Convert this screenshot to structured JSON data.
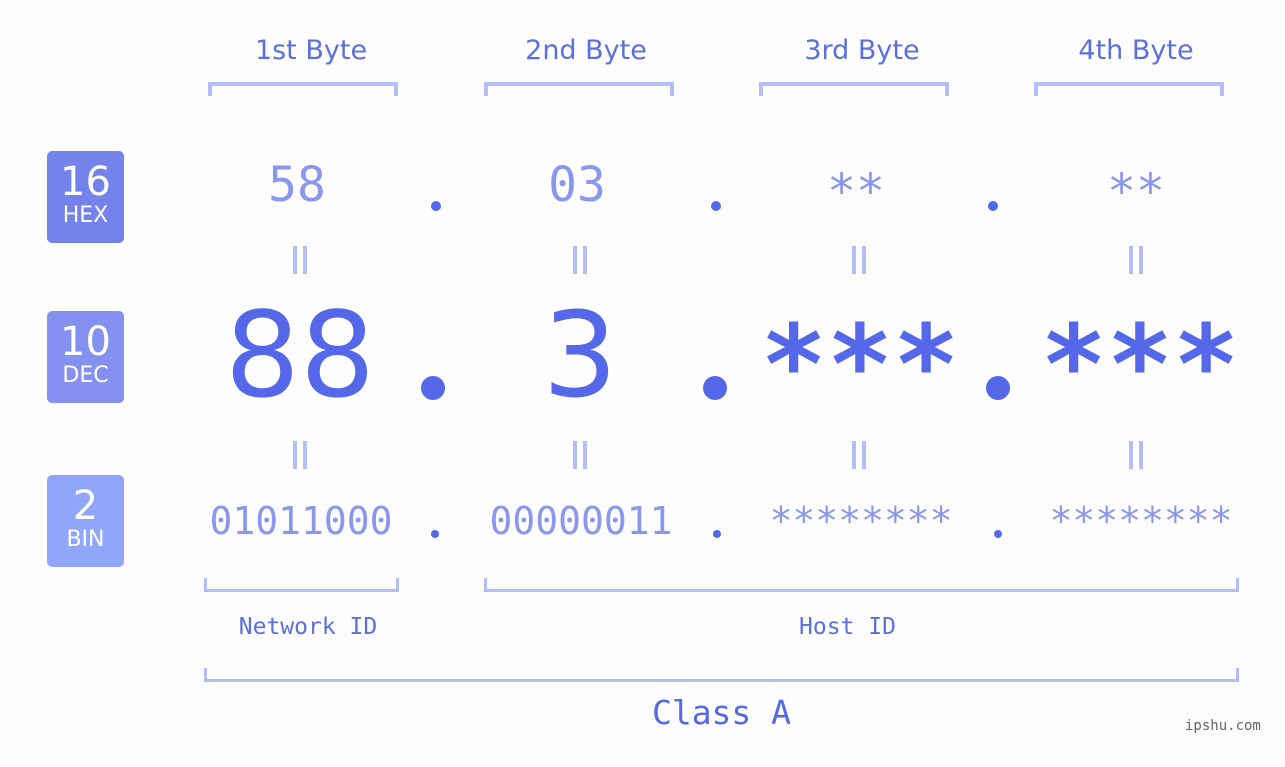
{
  "colors": {
    "hex_badge": "#7483ec",
    "dec_badge": "#8491f1",
    "bin_badge": "#90a6f8",
    "primary_text": "#5468e9",
    "secondary_text": "#8b97ec",
    "bracket": "#b3bdf7",
    "background": "#fcfdfc"
  },
  "badges": [
    {
      "number": "16",
      "label": "HEX"
    },
    {
      "number": "10",
      "label": "DEC"
    },
    {
      "number": "2",
      "label": "BIN"
    }
  ],
  "byte_headers": [
    "1st Byte",
    "2nd Byte",
    "3rd Byte",
    "4th Byte"
  ],
  "hex": [
    "58",
    "03",
    "**",
    "**"
  ],
  "dec": [
    "88",
    "3",
    "***",
    "***"
  ],
  "bin": [
    "01011000",
    "00000011",
    "********",
    "********"
  ],
  "separator": ".",
  "network_label": "Network ID",
  "host_label": "Host ID",
  "class_label": "Class A",
  "watermark": "ipshu.com"
}
